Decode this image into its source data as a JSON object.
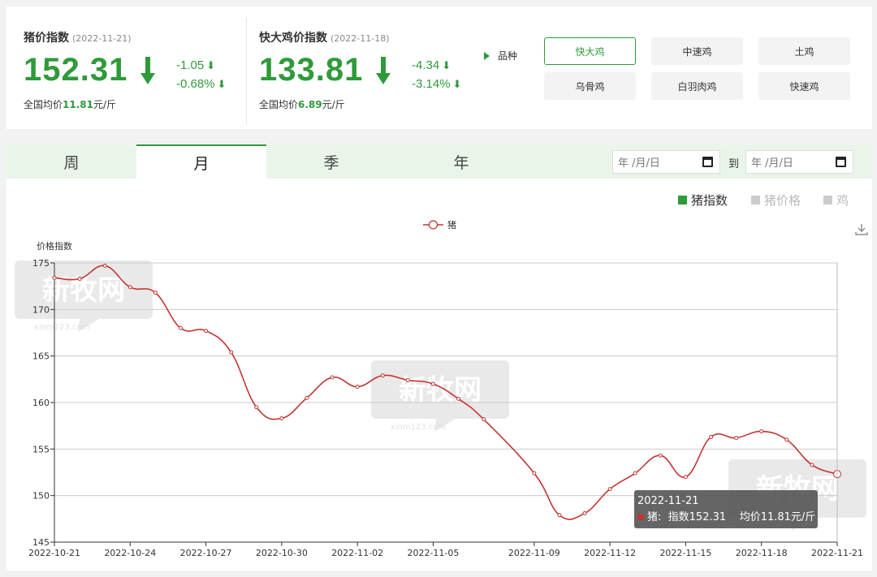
{
  "pig_index": {
    "title": "猪价指数",
    "date": "(2022-11-21)",
    "value": "152.31",
    "change_abs": "-1.05",
    "change_pct": "-0.68%",
    "avg_prefix": "全国均价",
    "avg_value": "11.81",
    "avg_unit": "元/斤"
  },
  "chicken_index": {
    "title": "快大鸡价指数",
    "date": "(2022-11-18)",
    "value": "133.81",
    "change_abs": "-4.34",
    "change_pct": "-3.14%",
    "avg_prefix": "全国均价",
    "avg_value": "6.89",
    "avg_unit": "元/斤"
  },
  "breeds": {
    "label": "品种",
    "items": [
      "快大鸡",
      "中速鸡",
      "土鸡",
      "乌骨鸡",
      "白羽肉鸡",
      "快速鸡"
    ],
    "selected": "快大鸡"
  },
  "tabs": [
    "周",
    "月",
    "季",
    "年"
  ],
  "active_tab": "月",
  "date_range": {
    "start_placeholder": "年 /月/日",
    "separator": "到",
    "end_placeholder": "年 /月/日"
  },
  "toggles": [
    {
      "label": "猪指数",
      "checked": true
    },
    {
      "label": "猪价格",
      "checked": false
    },
    {
      "label": "鸡",
      "checked": false
    }
  ],
  "watermark": {
    "text": "新牧网",
    "sub": "xinm123.com"
  },
  "tooltip": {
    "date": "2022-11-21",
    "series": "猪:",
    "index_label": "指数152.31",
    "price_label": "均价11.81元/斤"
  },
  "colors": {
    "accent": "#2f9a3a",
    "series": "#c23531"
  },
  "icons": [
    "down-arrow-icon",
    "play-triangle-icon",
    "calendar-icon",
    "download-icon"
  ],
  "chart_data": {
    "type": "line",
    "title": "",
    "ylabel": "价格指数",
    "xlabel": "",
    "legend": {
      "placement": "top-center",
      "items": [
        "猪"
      ]
    },
    "ylim": [
      145,
      175
    ],
    "yticks": [
      145,
      150,
      155,
      160,
      165,
      170,
      175
    ],
    "xticks": [
      "2022-10-21",
      "2022-10-24",
      "2022-10-27",
      "2022-10-30",
      "2022-11-02",
      "2022-11-05",
      "2022-11-09",
      "2022-11-12",
      "2022-11-15",
      "2022-11-18",
      "2022-11-21"
    ],
    "grid": true,
    "series": [
      {
        "name": "猪",
        "x": [
          "2022-10-21",
          "2022-10-22",
          "2022-10-23",
          "2022-10-24",
          "2022-10-25",
          "2022-10-26",
          "2022-10-27",
          "2022-10-28",
          "2022-10-29",
          "2022-10-30",
          "2022-10-31",
          "2022-11-01",
          "2022-11-02",
          "2022-11-03",
          "2022-11-04",
          "2022-11-05",
          "2022-11-06",
          "2022-11-07",
          "2022-11-09",
          "2022-11-10",
          "2022-11-11",
          "2022-11-12",
          "2022-11-13",
          "2022-11-14",
          "2022-11-15",
          "2022-11-16",
          "2022-11-17",
          "2022-11-18",
          "2022-11-19",
          "2022-11-20",
          "2022-11-21"
        ],
        "values": [
          173.4,
          173.3,
          174.7,
          172.4,
          171.8,
          168.0,
          167.7,
          165.4,
          159.5,
          158.3,
          160.5,
          162.7,
          161.7,
          162.9,
          162.4,
          162.0,
          160.4,
          158.2,
          152.4,
          147.9,
          148.1,
          150.7,
          152.4,
          154.3,
          152.0,
          156.3,
          156.2,
          156.9,
          156.0,
          153.3,
          152.31
        ]
      }
    ]
  }
}
